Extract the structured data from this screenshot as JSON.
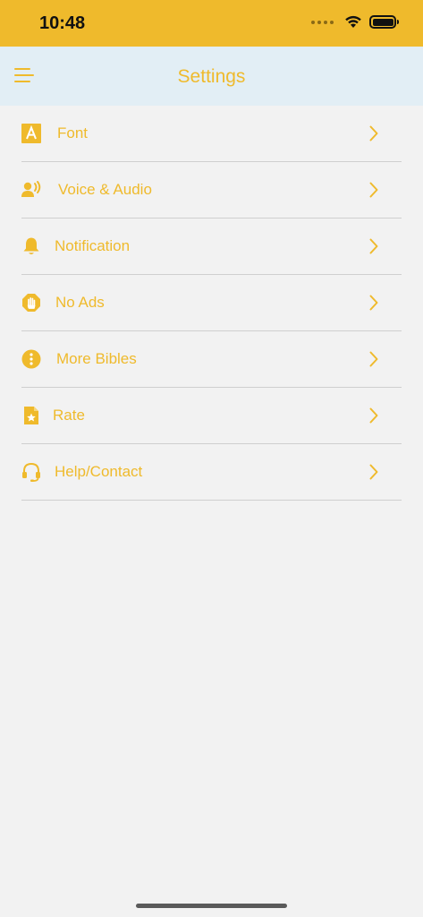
{
  "status_bar": {
    "time": "10:48"
  },
  "header": {
    "title": "Settings",
    "menu_icon": "hamburger-menu-icon"
  },
  "colors": {
    "accent": "#efba2c",
    "header_bg": "#e2eef5",
    "background": "#f2f2f2",
    "divider": "#cfcfcf"
  },
  "settings": {
    "items": [
      {
        "label": "Font",
        "icon": "font-icon"
      },
      {
        "label": "Voice & Audio",
        "icon": "voice-icon"
      },
      {
        "label": "Notification",
        "icon": "bell-icon"
      },
      {
        "label": "No Ads",
        "icon": "hand-stop-icon"
      },
      {
        "label": "More Bibles",
        "icon": "info-circle-icon"
      },
      {
        "label": "Rate",
        "icon": "star-document-icon"
      },
      {
        "label": "Help/Contact",
        "icon": "headset-icon"
      }
    ]
  }
}
